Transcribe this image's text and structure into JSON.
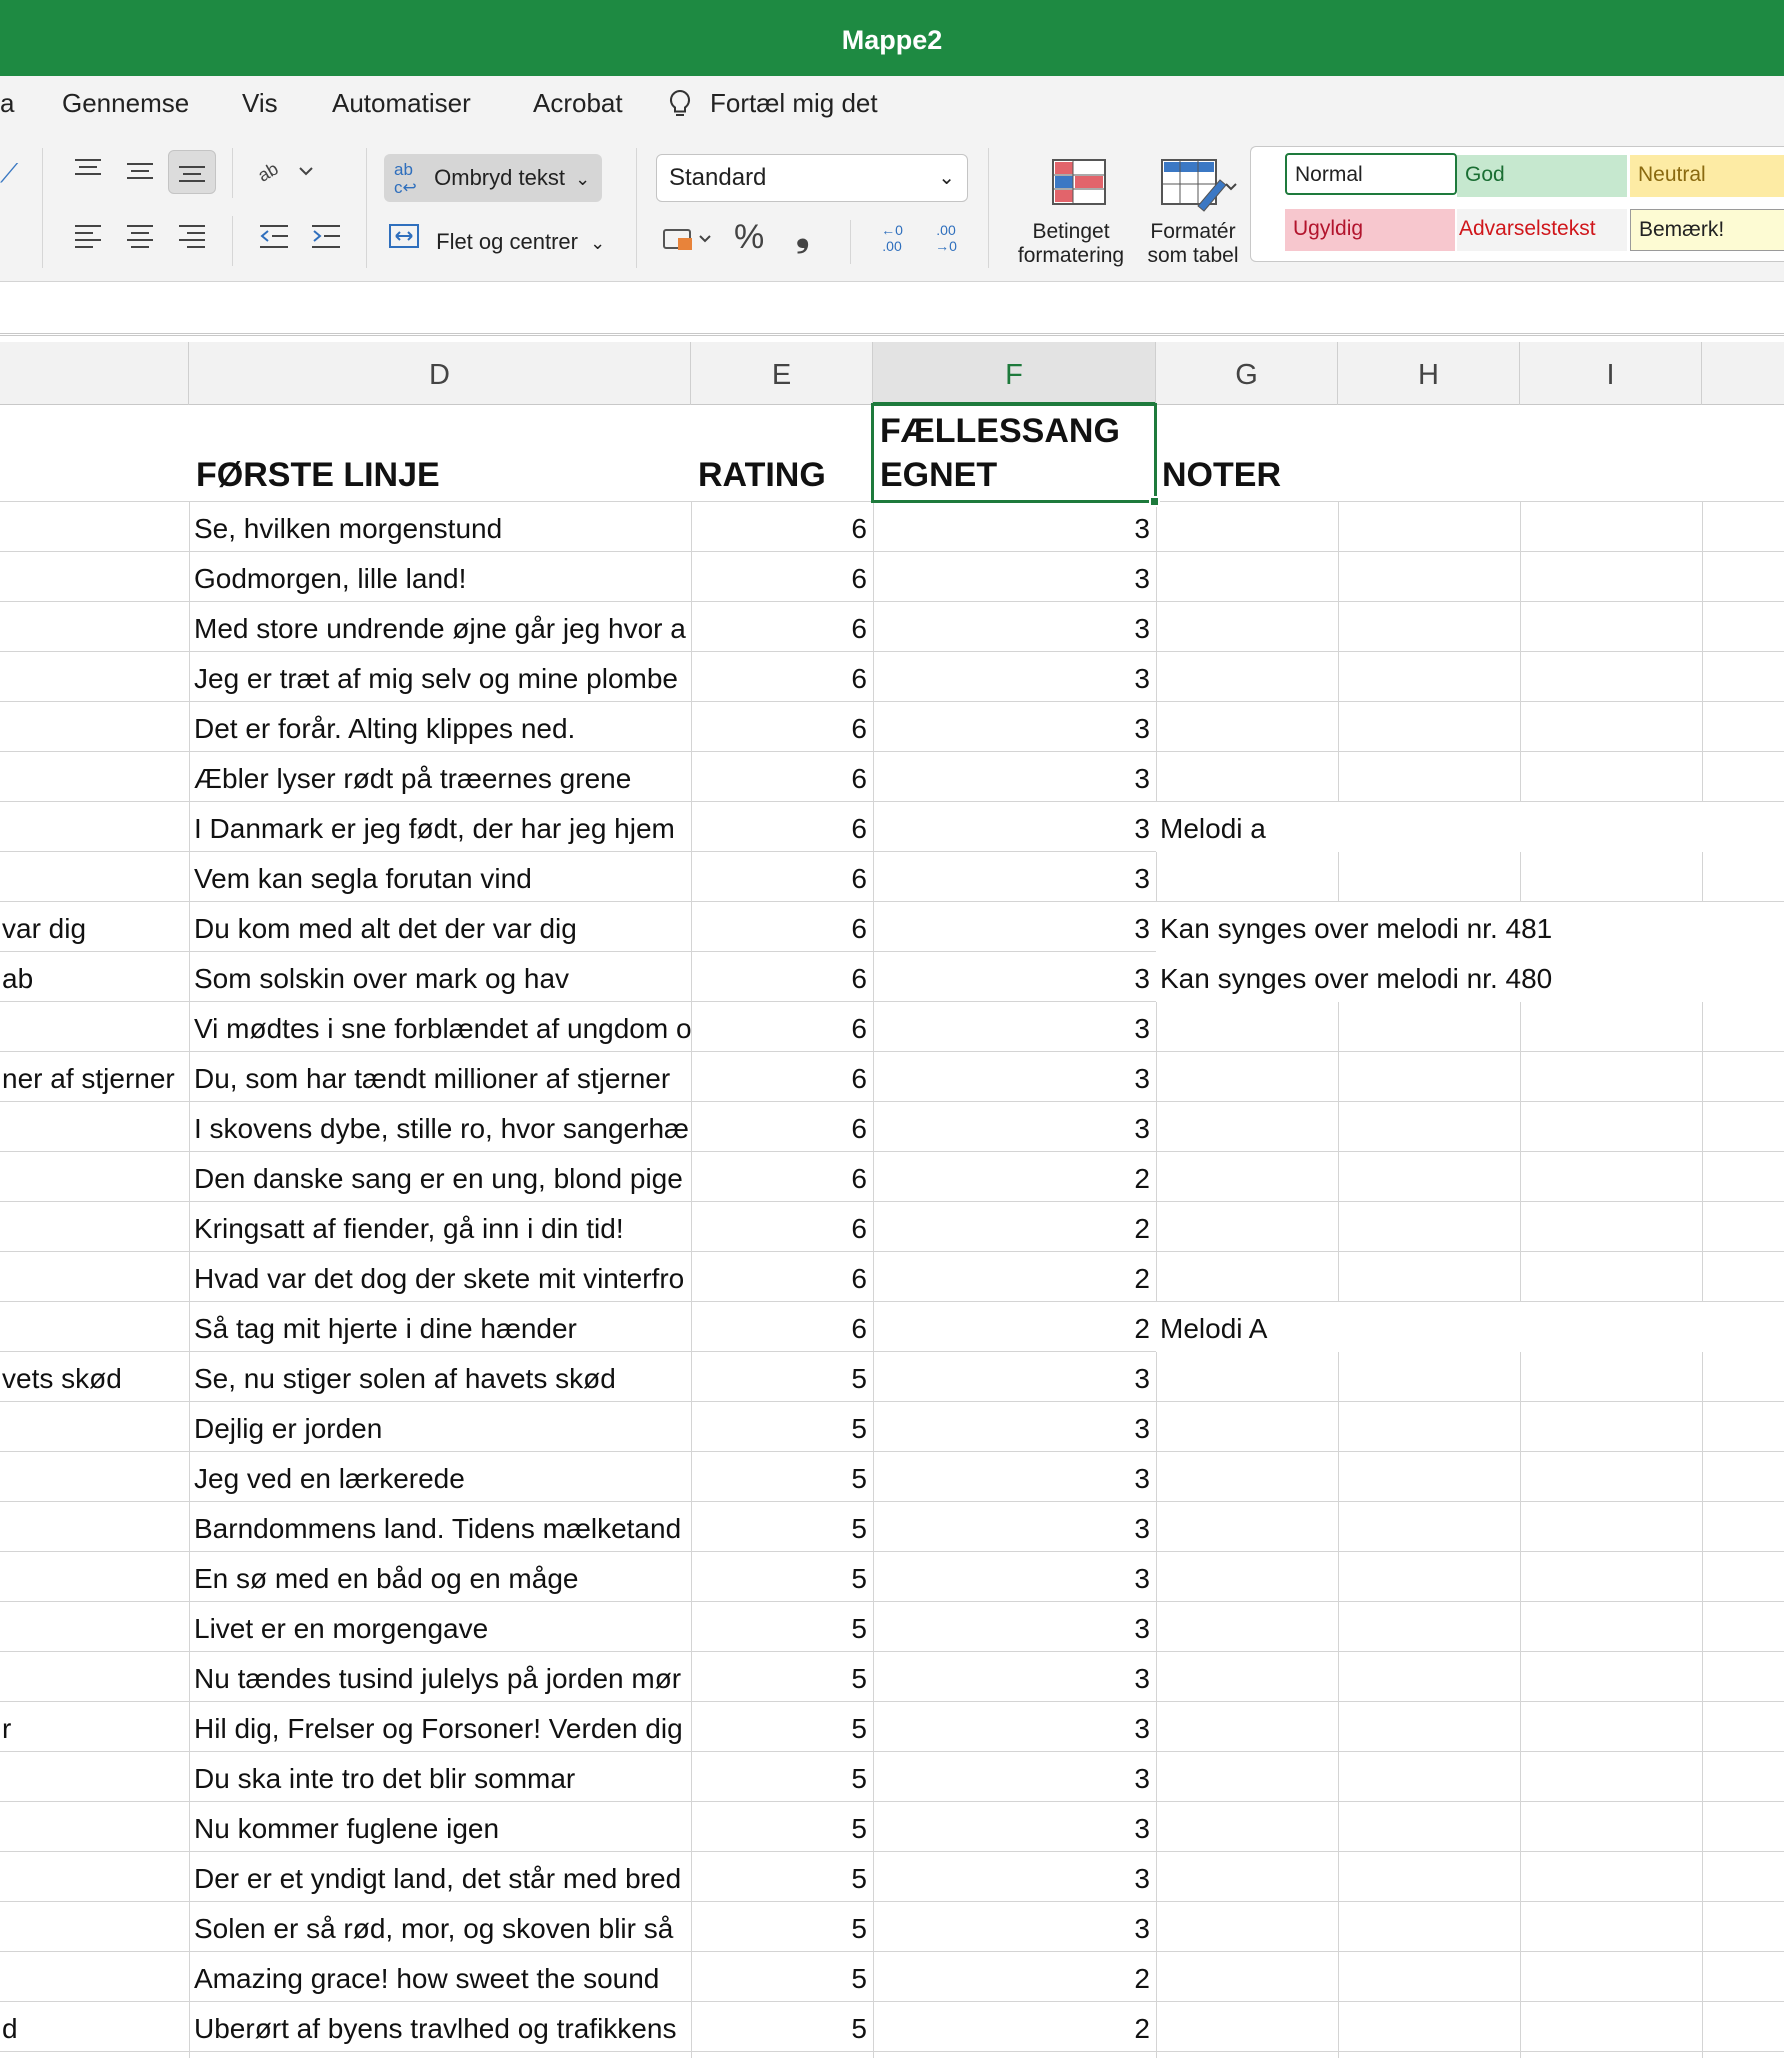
{
  "window": {
    "title": "Mappe2"
  },
  "menu": {
    "partial_left": "a",
    "items": [
      "Gennemse",
      "Vis",
      "Automatiser",
      "Acrobat"
    ],
    "tell_me": "Fortæl mig det"
  },
  "ribbon": {
    "wrap_text": "Ombryd tekst",
    "merge_center": "Flet og centrer",
    "number_format": "Standard",
    "percent": "%",
    "comma": "❟",
    "inc_decimal": "←0\n.00",
    "dec_decimal": ".00\n→0",
    "conditional_formatting": [
      "Betinget",
      "formatering"
    ],
    "format_as_table": [
      "Formatér",
      "som tabel"
    ],
    "styles": [
      {
        "label": "Normal",
        "bg": "#ffffff",
        "fg": "#222222"
      },
      {
        "label": "God",
        "bg": "#c6e8cf",
        "fg": "#1a6e33"
      },
      {
        "label": "Neutral",
        "bg": "#fdeba4",
        "fg": "#8a6a10"
      },
      {
        "label": "Ugyldig",
        "bg": "#f7c7ce",
        "fg": "#b2142d"
      },
      {
        "label": "Advarselstekst",
        "bg": "#f3f3f3",
        "fg": "#d0161b"
      },
      {
        "label": "Bemærk!",
        "bg": "#fdfbd3",
        "fg": "#222222"
      }
    ]
  },
  "columns": [
    "D",
    "E",
    "F",
    "G",
    "H",
    "I"
  ],
  "selected_column": "F",
  "header_row": {
    "d": "FØRSTE LINJE",
    "e": "RATING",
    "f": [
      "FÆLLESSANG",
      "EGNET"
    ],
    "g": "NOTER"
  },
  "rows": [
    {
      "c": "",
      "d": "Se, hvilken morgenstund",
      "e": "6",
      "f": "3",
      "g": ""
    },
    {
      "c": "",
      "d": "Godmorgen, lille land!",
      "e": "6",
      "f": "3",
      "g": ""
    },
    {
      "c": "",
      "d": "Med store undrende øjne går jeg hvor a",
      "e": "6",
      "f": "3",
      "g": ""
    },
    {
      "c": "",
      "d": "Jeg er træt af mig selv og mine plombe",
      "e": "6",
      "f": "3",
      "g": ""
    },
    {
      "c": "",
      "d": "Det er forår. Alting klippes ned.",
      "e": "6",
      "f": "3",
      "g": ""
    },
    {
      "c": "",
      "d": "Æbler lyser rødt på træernes grene",
      "e": "6",
      "f": "3",
      "g": ""
    },
    {
      "c": "",
      "d": "I Danmark er jeg født, der har jeg hjem",
      "e": "6",
      "f": "3",
      "g": "Melodi a"
    },
    {
      "c": "",
      "d": "Vem kan segla forutan vind",
      "e": "6",
      "f": "3",
      "g": ""
    },
    {
      "c": "var dig",
      "d": "Du kom med alt det der var dig",
      "e": "6",
      "f": "3",
      "g": "Kan synges over melodi nr. 481"
    },
    {
      "c": "ab",
      "d": "Som solskin over mark og hav",
      "e": "6",
      "f": "3",
      "g": "Kan synges over melodi nr. 480"
    },
    {
      "c": "",
      "d": "Vi mødtes i sne forblændet af ungdom o",
      "e": "6",
      "f": "3",
      "g": ""
    },
    {
      "c": "ner af stjerner",
      "d": "Du, som har tændt millioner af stjerner",
      "e": "6",
      "f": "3",
      "g": ""
    },
    {
      "c": "",
      "d": "I skovens dybe, stille ro, hvor sangerhæ",
      "e": "6",
      "f": "3",
      "g": ""
    },
    {
      "c": "",
      "d": "Den danske sang er en ung, blond pige",
      "e": "6",
      "f": "2",
      "g": ""
    },
    {
      "c": "",
      "d": "Kringsatt af fiender, gå inn i din tid!",
      "e": "6",
      "f": "2",
      "g": ""
    },
    {
      "c": "",
      "d": "Hvad var det dog der skete mit vinterfro",
      "e": "6",
      "f": "2",
      "g": ""
    },
    {
      "c": "",
      "d": "Så tag mit hjerte i dine hænder",
      "e": "6",
      "f": "2",
      "g": "Melodi A"
    },
    {
      "c": "vets skød",
      "d": "Se, nu stiger solen af havets skød",
      "e": "5",
      "f": "3",
      "g": ""
    },
    {
      "c": "",
      "d": "Dejlig er jorden",
      "e": "5",
      "f": "3",
      "g": ""
    },
    {
      "c": "",
      "d": "Jeg ved en lærkerede",
      "e": "5",
      "f": "3",
      "g": ""
    },
    {
      "c": "",
      "d": "Barndommens land. Tidens mælketand",
      "e": "5",
      "f": "3",
      "g": ""
    },
    {
      "c": "",
      "d": "En sø med en båd og en måge",
      "e": "5",
      "f": "3",
      "g": ""
    },
    {
      "c": "",
      "d": "Livet er en morgengave",
      "e": "5",
      "f": "3",
      "g": ""
    },
    {
      "c": "",
      "d": "Nu tændes tusind julelys på jorden mør",
      "e": "5",
      "f": "3",
      "g": ""
    },
    {
      "c": "r",
      "d": "Hil dig, Frelser og Forsoner! Verden dig",
      "e": "5",
      "f": "3",
      "g": ""
    },
    {
      "c": "",
      "d": "Du ska inte tro det blir sommar",
      "e": "5",
      "f": "3",
      "g": ""
    },
    {
      "c": "",
      "d": "Nu kommer fuglene igen",
      "e": "5",
      "f": "3",
      "g": ""
    },
    {
      "c": "",
      "d": "Der er et yndigt land, det står med bred",
      "e": "5",
      "f": "3",
      "g": ""
    },
    {
      "c": "",
      "d": "Solen er så rød, mor, og skoven blir så",
      "e": "5",
      "f": "3",
      "g": ""
    },
    {
      "c": "",
      "d": "Amazing grace! how sweet the sound",
      "e": "5",
      "f": "2",
      "g": ""
    },
    {
      "c": "d",
      "d": "Uberørt af byens travlhed og trafikkens",
      "e": "5",
      "f": "2",
      "g": ""
    }
  ]
}
